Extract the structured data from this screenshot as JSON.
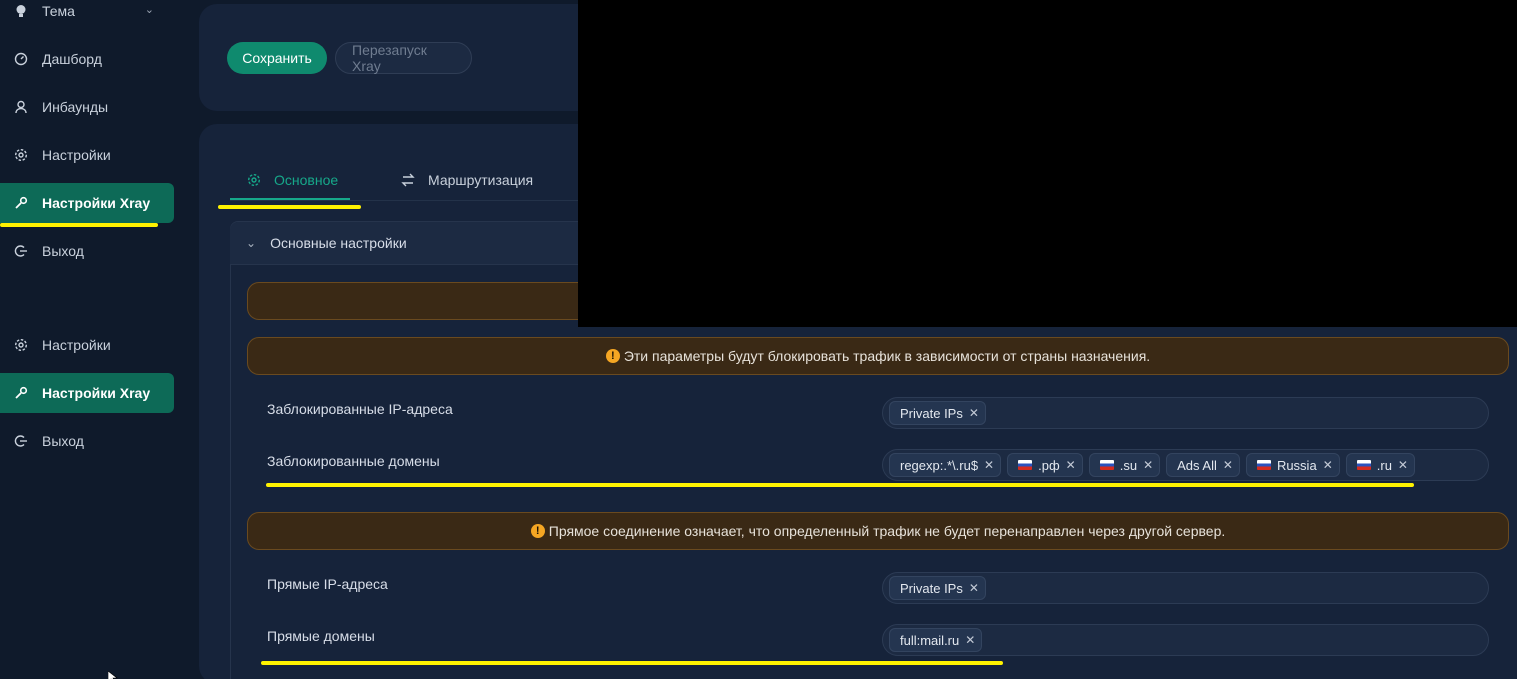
{
  "sidebar": {
    "items": [
      {
        "label": "Тема",
        "icon": "bulb-icon"
      },
      {
        "label": "Дашборд",
        "icon": "dashboard-icon"
      },
      {
        "label": "Инбаунды",
        "icon": "user-icon"
      },
      {
        "label": "Настройки",
        "icon": "gear-icon"
      },
      {
        "label": "Настройки Xray",
        "icon": "tool-icon",
        "active": true
      },
      {
        "label": "Выход",
        "icon": "logout-icon"
      },
      {
        "label": "Настройки",
        "icon": "gear-icon"
      },
      {
        "label": "Настройки Xray",
        "icon": "tool-icon",
        "active": true
      },
      {
        "label": "Выход",
        "icon": "logout-icon"
      }
    ]
  },
  "toolbar": {
    "save_label": "Сохранить",
    "restart_label": "Перезапуск Xray"
  },
  "tabs": [
    {
      "label": "Основное",
      "icon": "gear-icon",
      "active": true
    },
    {
      "label": "Маршрутизация",
      "icon": "swap-icon"
    }
  ],
  "panel": {
    "title": "Основные настройки"
  },
  "alerts": {
    "block": "Эти параметры будут блокировать трафик в зависимости от страны назначения.",
    "direct": "Прямое соединение означает, что определенный трафик не будет перенаправлен через другой сервер."
  },
  "fields": {
    "blocked_ips": {
      "label": "Заблокированные IP-адреса",
      "tags": [
        {
          "text": "Private IPs"
        }
      ]
    },
    "blocked_domains": {
      "label": "Заблокированные домены",
      "tags": [
        {
          "text": "regexp:.*\\.ru$"
        },
        {
          "text": ".рф",
          "flag": "ru"
        },
        {
          "text": ".su",
          "flag": "ru"
        },
        {
          "text": "Ads All"
        },
        {
          "text": "Russia",
          "flag": "ru"
        },
        {
          "text": ".ru",
          "flag": "ru"
        }
      ]
    },
    "direct_ips": {
      "label": "Прямые IP-адреса",
      "tags": [
        {
          "text": "Private IPs"
        }
      ]
    },
    "direct_domains": {
      "label": "Прямые домены",
      "tags": [
        {
          "text": "full:mail.ru"
        }
      ]
    }
  },
  "colors": {
    "accent": "#0f8a6e",
    "highlight": "#fff200",
    "alert_bg": "#3a2915"
  }
}
